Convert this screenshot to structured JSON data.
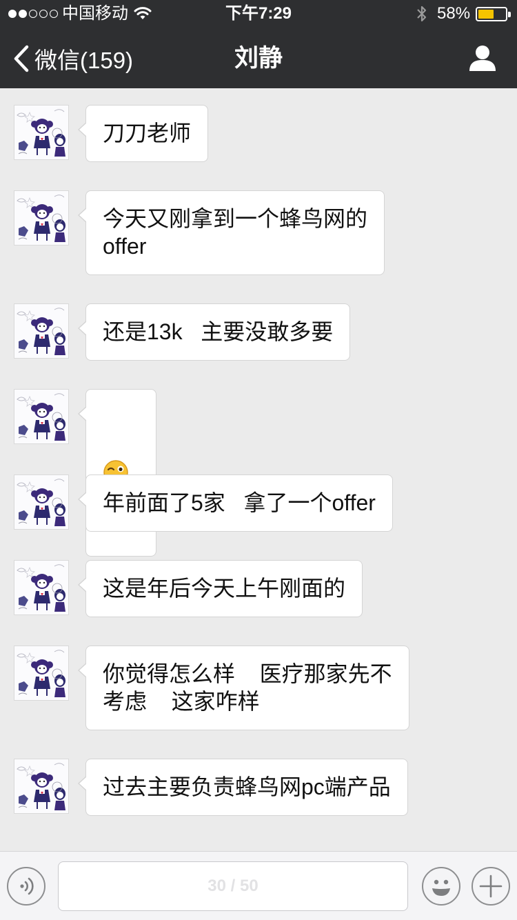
{
  "status_bar": {
    "carrier": "中国移动",
    "time": "下午7:29",
    "battery_percent": "58%",
    "battery_level": 0.58,
    "signal_bars_filled": 2,
    "signal_bars_total": 5,
    "icons": [
      "wifi-icon",
      "bluetooth-icon",
      "battery-icon"
    ]
  },
  "nav": {
    "back_label": "微信(159)",
    "title": "刘静",
    "right_icon": "person-icon"
  },
  "messages": [
    {
      "text": "刀刀老师"
    },
    {
      "text": "今天又刚拿到一个蜂鸟网的\noffer"
    },
    {
      "text": "还是13k   主要没敢多要"
    },
    {
      "text": "",
      "emoji": "winking-face-tongue"
    },
    {
      "text": "年前面了5家   拿了一个offer"
    },
    {
      "text": "这是年后今天上午刚面的"
    },
    {
      "text": "你觉得怎么样    医疗那家先不\n考虑    这家咋样"
    },
    {
      "text": "过去主要负责蜂鸟网pc端产品"
    }
  ],
  "input_bar": {
    "field_overlay": "30 / 50",
    "left_icon": "voice-icon",
    "right_icons": [
      "emoji-icon",
      "plus-icon"
    ]
  },
  "colors": {
    "nav_background": "#2e2f31",
    "chat_background": "#ebebeb",
    "bubble_background": "#ffffff",
    "battery_fill": "#f5c400"
  }
}
